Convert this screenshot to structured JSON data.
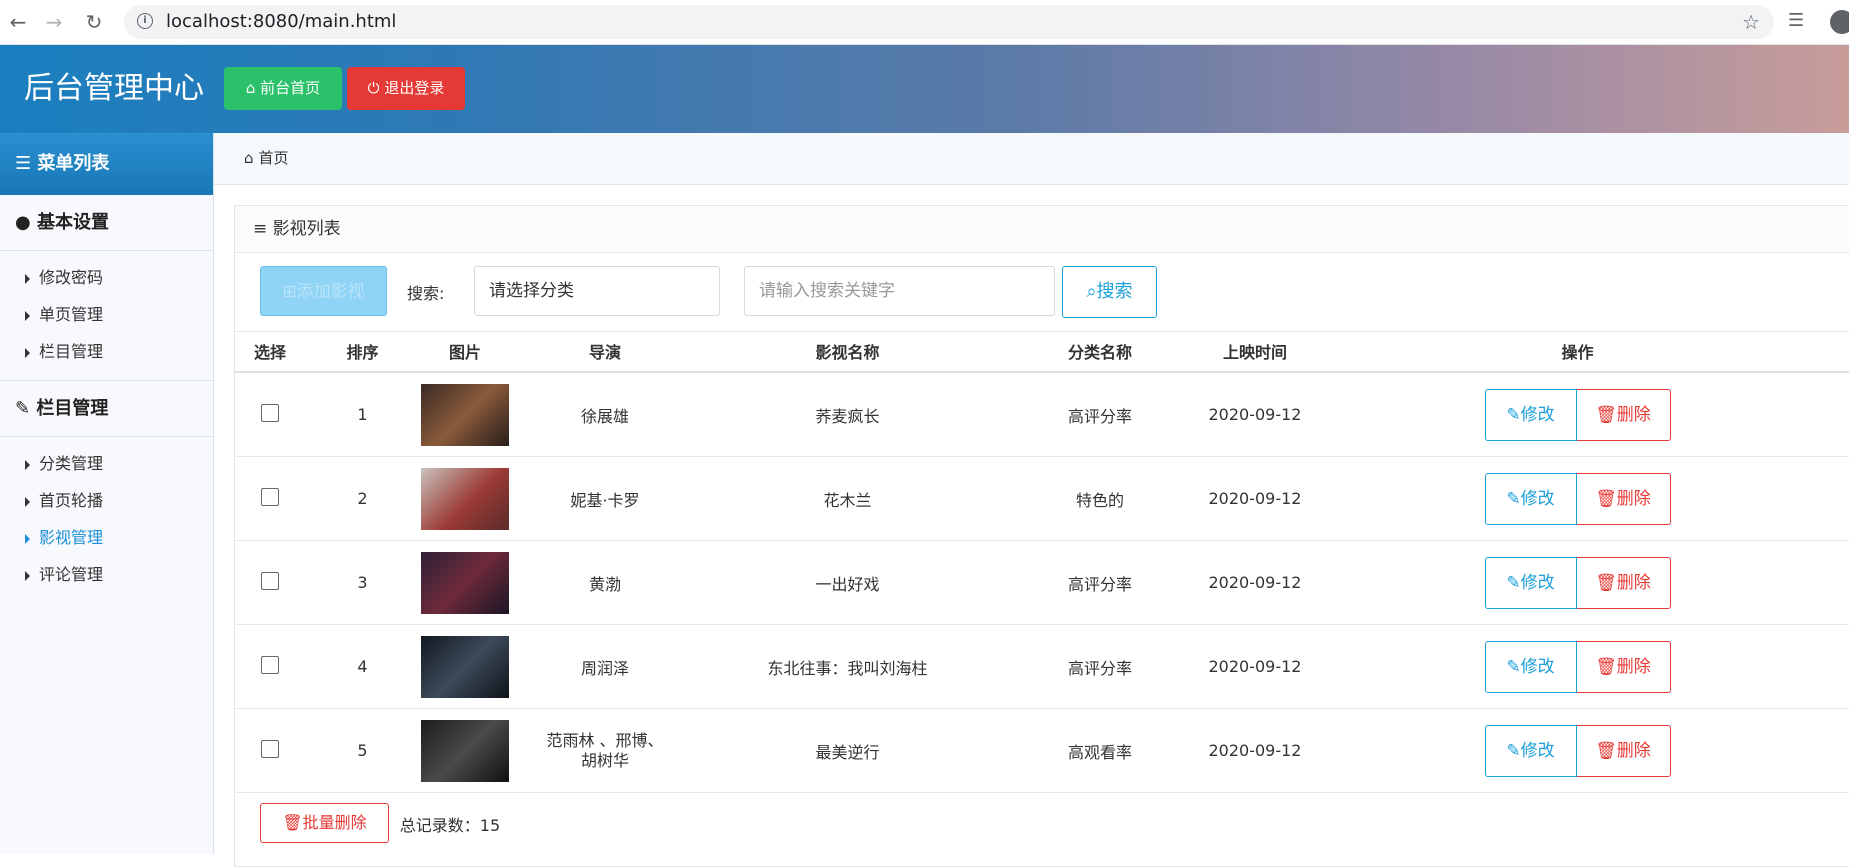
{
  "browser": {
    "back_icon": "←",
    "forward_icon": "→",
    "reload_icon": "↻",
    "url": "localhost:8080/main.html"
  },
  "header": {
    "title": "后台管理中心",
    "home_button": "前台首页",
    "logout_button": "退出登录",
    "colors": {
      "home": "#2ac16a",
      "logout": "#e53935"
    }
  },
  "sidebar": {
    "title": "菜单列表",
    "groups": [
      {
        "title": "基本设置",
        "items": [
          "修改密码",
          "单页管理",
          "栏目管理"
        ]
      },
      {
        "title": "栏目管理",
        "items": [
          "分类管理",
          "首页轮播",
          "影视管理",
          "评论管理"
        ]
      }
    ],
    "active_item": "影视管理"
  },
  "breadcrumb": {
    "home": "首页"
  },
  "panel": {
    "title": "影视列表",
    "add_button": "添加影视",
    "search_label": "搜索:",
    "category_select": "请选择分类",
    "keyword_placeholder": "请输入搜索关键字",
    "search_button": "搜索"
  },
  "table": {
    "headers": [
      "选择",
      "排序",
      "图片",
      "导演",
      "影视名称",
      "分类名称",
      "上映时间",
      "操作"
    ],
    "rows": [
      {
        "order": "1",
        "director": "徐展雄",
        "name": "荞麦疯长",
        "category": "高评分率",
        "date": "2020-09-12"
      },
      {
        "order": "2",
        "director": "妮基·卡罗",
        "name": "花木兰",
        "category": "特色的",
        "date": "2020-09-12"
      },
      {
        "order": "3",
        "director": "黄渤",
        "name": "一出好戏",
        "category": "高评分率",
        "date": "2020-09-12"
      },
      {
        "order": "4",
        "director": "周润泽",
        "name": "东北往事：我叫刘海柱",
        "category": "高评分率",
        "date": "2020-09-12"
      },
      {
        "order": "5",
        "director": "范雨林 、邢博、胡树华",
        "name": "最美逆行",
        "category": "高观看率",
        "date": "2020-09-12"
      }
    ],
    "edit_label": "修改",
    "delete_label": "删除"
  },
  "footer": {
    "batch_delete": "批量删除",
    "total_label": "总记录数：",
    "total": "15"
  }
}
